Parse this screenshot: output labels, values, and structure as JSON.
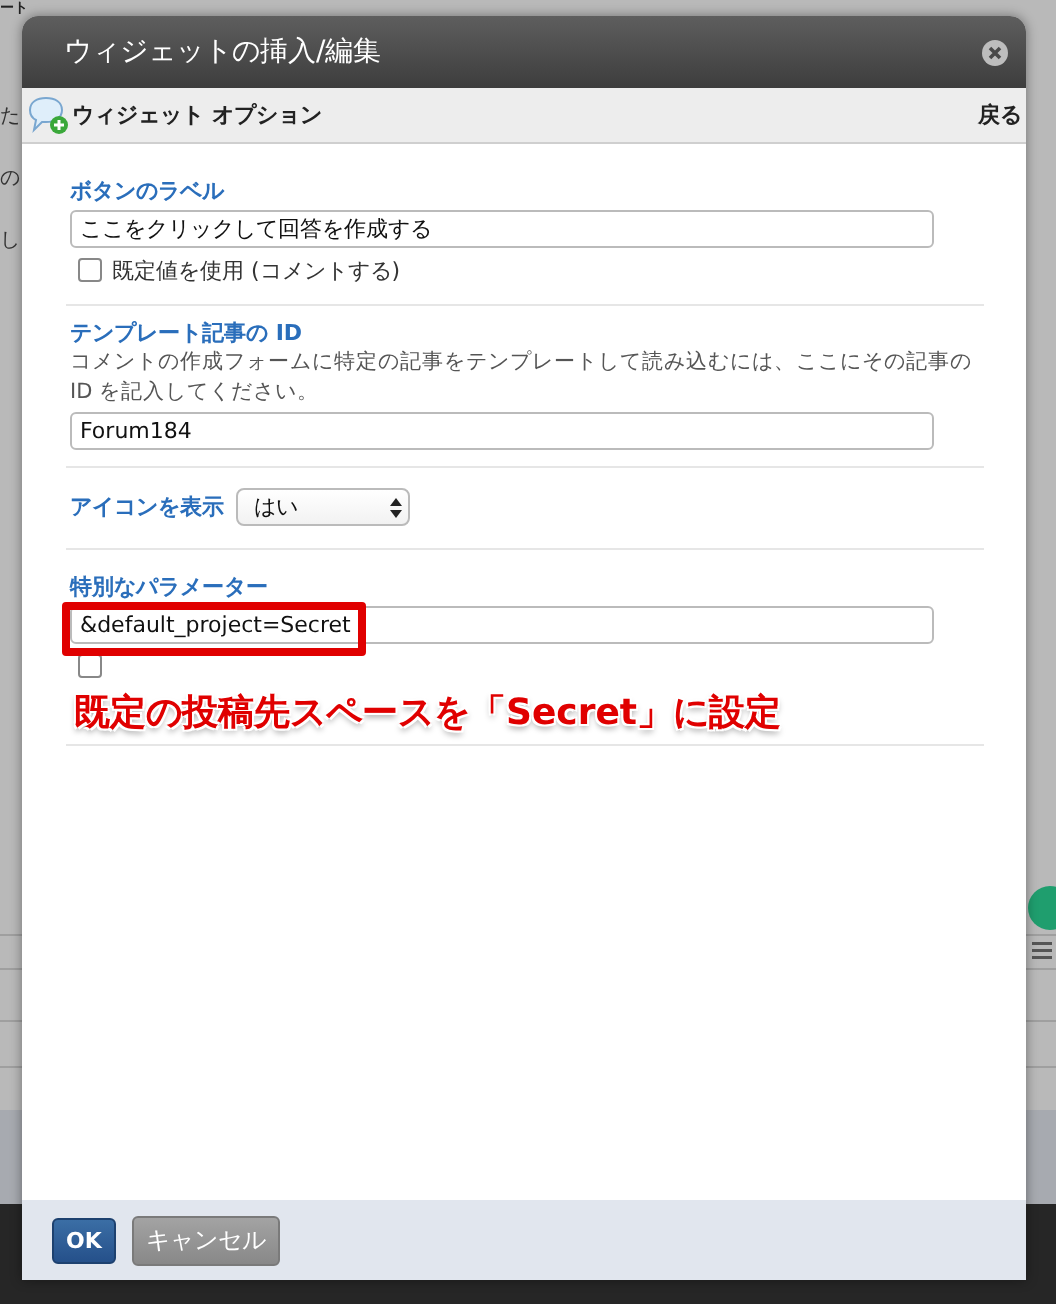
{
  "background": {
    "title": "ート",
    "fragments": [
      "た",
      "の",
      "し"
    ]
  },
  "dialog": {
    "title": "ウィジェットの挿入/編集",
    "subtitle": "ウィジェット オプション",
    "back": "戻る",
    "sections": [
      {
        "kind": "text",
        "label": "ボタンのラベル",
        "value": "ここをクリックして回答を作成する",
        "checkbox": {
          "label": "既定値を使用 (コメントする)",
          "checked": false
        }
      },
      {
        "kind": "text",
        "label": "テンプレート記事の ID",
        "description": "コメントの作成フォームに特定の記事をテンプレートして読み込むには、ここにその記事の ID を記入してください。",
        "value": "Forum184"
      },
      {
        "kind": "select",
        "label": "アイコンを表示",
        "value": "はい"
      },
      {
        "kind": "text",
        "label": "特別なパラメーター",
        "value": "&default_project=Secret",
        "checkbox": {
          "checked": false
        },
        "highlighted": true
      }
    ],
    "annotation": "既定の投稿先スペースを「Secret」に設定",
    "buttons": [
      {
        "label": "OK",
        "kind": "primary"
      },
      {
        "label": "キャンセル",
        "kind": "secondary"
      }
    ]
  }
}
